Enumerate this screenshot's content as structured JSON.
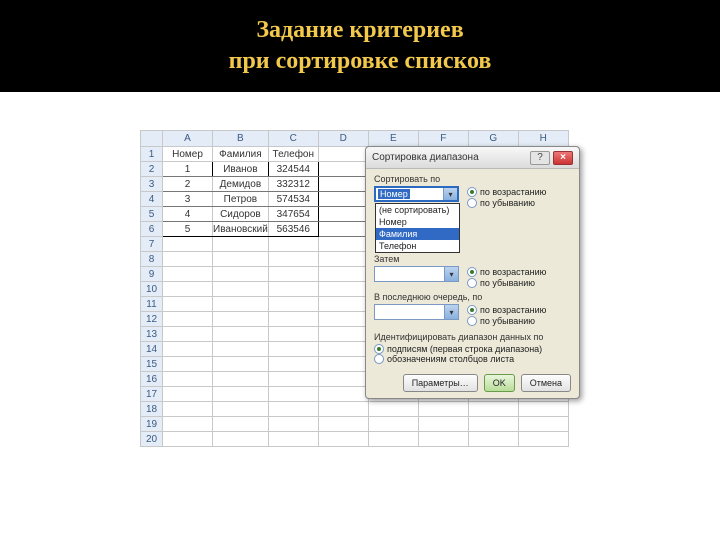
{
  "title": {
    "line1": "Задание критериев",
    "line2": "при сортировке списков"
  },
  "sheet": {
    "cols": [
      "A",
      "B",
      "C",
      "D",
      "E",
      "F",
      "G",
      "H"
    ],
    "rows": [
      "1",
      "2",
      "3",
      "4",
      "5",
      "6",
      "7",
      "8",
      "9",
      "10",
      "11",
      "12",
      "13",
      "14",
      "15",
      "16",
      "17",
      "18",
      "19",
      "20"
    ],
    "data": [
      [
        "Номер",
        "Фамилия",
        "Телефон",
        "",
        "",
        "",
        "",
        ""
      ],
      [
        "1",
        "Иванов",
        "324544",
        "",
        "",
        "",
        "",
        ""
      ],
      [
        "2",
        "Демидов",
        "332312",
        "",
        "",
        "",
        "",
        ""
      ],
      [
        "3",
        "Петров",
        "574534",
        "",
        "",
        "",
        "",
        ""
      ],
      [
        "4",
        "Сидоров",
        "347654",
        "",
        "",
        "",
        "",
        ""
      ],
      [
        "5",
        "Ивановский",
        "563546",
        "",
        "",
        "",
        "",
        ""
      ]
    ]
  },
  "dialog": {
    "title": "Сортировка диапазона",
    "help_icon": "?",
    "close_icon": "×",
    "sort_by": "Сортировать по",
    "then_by": "Затем",
    "last_by": "В последнюю очередь, по",
    "asc": "по возрастанию",
    "desc": "по убыванию",
    "ident_label": "Идентифицировать диапазон данных по",
    "ident_opt1": "подписям (первая строка диапазона)",
    "ident_opt2": "обозначениям столбцов листа",
    "combo1_value": "Номер",
    "combo2_value": "",
    "combo3_value": "",
    "dropdown": [
      "(не сортировать)",
      "Номер",
      "Фамилия",
      "Телефон"
    ],
    "btn_params": "Параметры…",
    "btn_ok": "OK",
    "btn_cancel": "Отмена"
  }
}
